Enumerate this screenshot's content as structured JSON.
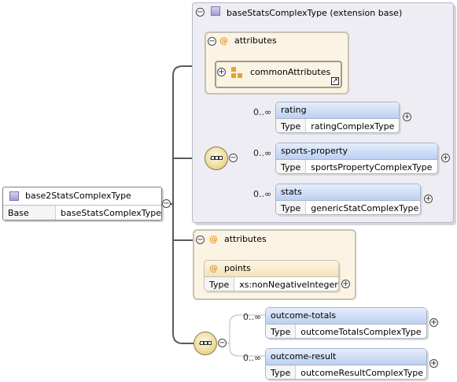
{
  "root": {
    "name": "base2StatsComplexType",
    "base_type_label": "Base Type",
    "base_type_value": "baseStatsComplexType"
  },
  "extension": {
    "title": "baseStatsComplexType (extension base)",
    "attributes_label": "attributes",
    "common_attributes": "commonAttributes",
    "elements": [
      {
        "name": "rating",
        "type_label": "Type",
        "type": "ratingComplexType",
        "card": "0..∞"
      },
      {
        "name": "sports-property",
        "type_label": "Type",
        "type": "sportsPropertyComplexType",
        "card": "0..∞"
      },
      {
        "name": "stats",
        "type_label": "Type",
        "type": "genericStatComplexType",
        "card": "0..∞"
      }
    ]
  },
  "attributes": {
    "label": "attributes",
    "points": {
      "name": "points",
      "type_label": "Type",
      "type": "xs:nonNegativeInteger"
    }
  },
  "elements": [
    {
      "name": "outcome-totals",
      "type_label": "Type",
      "type": "outcomeTotalsComplexType",
      "card": "0..∞"
    },
    {
      "name": "outcome-result",
      "type_label": "Type",
      "type": "outcomeResultComplexType",
      "card": "0..∞"
    }
  ],
  "symbols": {
    "collapse": "−",
    "expand": "+",
    "at": "@",
    "ref_arrow": "↗"
  }
}
